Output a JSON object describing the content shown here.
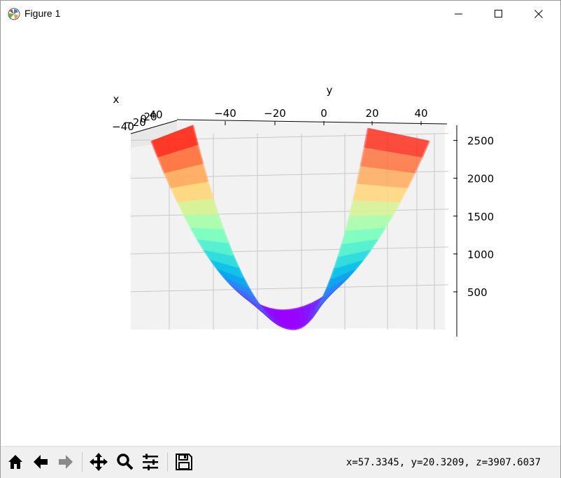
{
  "window": {
    "title": "Figure 1"
  },
  "icons": {
    "app": "matplotlib-icon",
    "minimize": "minimize-icon",
    "maximize": "maximize-icon",
    "close": "close-icon"
  },
  "chart_data": {
    "type": "surface",
    "x_axis": {
      "label": "x",
      "ticks": [
        "−40",
        "−20",
        "0",
        "20",
        "40"
      ],
      "range": [
        -45,
        45
      ]
    },
    "y_axis": {
      "label": "y",
      "ticks": [
        "−40",
        "−20",
        "0",
        "20",
        "40"
      ],
      "range": [
        -50,
        50
      ]
    },
    "z_axis": {
      "label": "",
      "ticks": [
        "500",
        "1000",
        "1500",
        "2000",
        "2500"
      ],
      "range": [
        0,
        2700
      ]
    },
    "surface": "z = y²",
    "colormap": "rainbow",
    "grid": true
  },
  "toolbar": {
    "buttons": [
      {
        "name": "home-button",
        "icon": "home-icon"
      },
      {
        "name": "back-button",
        "icon": "back-arrow-icon"
      },
      {
        "name": "forward-button",
        "icon": "forward-arrow-icon"
      },
      {
        "name": "pan-button",
        "icon": "pan-icon"
      },
      {
        "name": "zoom-button",
        "icon": "zoom-icon"
      },
      {
        "name": "subplots-button",
        "icon": "sliders-icon"
      },
      {
        "name": "save-button",
        "icon": "save-icon"
      }
    ],
    "coords": "x=57.3345,  y=20.3209,  z=3907.6037"
  }
}
